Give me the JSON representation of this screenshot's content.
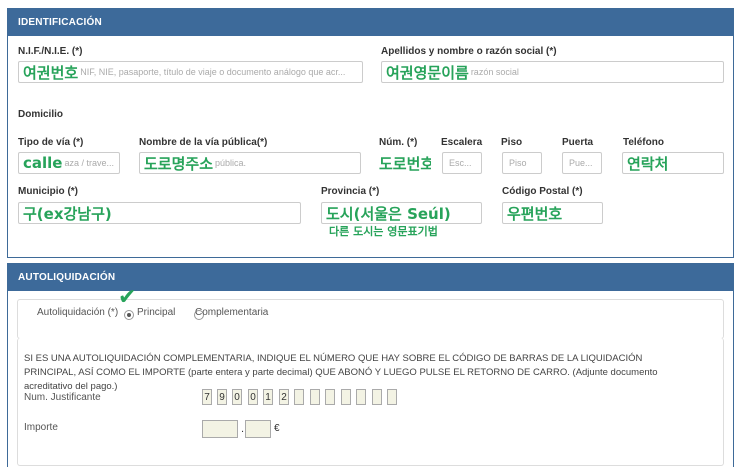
{
  "identificacion": {
    "header": "IDENTIFICACIÓN",
    "nif_label": "N.I.F./N.I.E. (*)",
    "nif_hand": "여권번호",
    "nif_placeholder": "NIF, NIE, pasaporte, título de viaje o documento análogo que acr...",
    "apellidos_label": "Apellidos y nombre o razón social (*)",
    "apellidos_hand": "여권영문이름",
    "apellidos_placeholder": "razón social",
    "domicilio_label": "Domicilio",
    "tipo_via_label": "Tipo de vía (*)",
    "tipo_via_hand": "calle",
    "tipo_via_placeholder": "aza / trave...",
    "nombre_via_label": "Nombre de la vía pública(*)",
    "nombre_via_hand": "도로명주소",
    "nombre_via_placeholder": "pública.",
    "num_label": "Núm. (*)",
    "num_hand": "도로번호",
    "escalera_label": "Escalera",
    "escalera_placeholder": "Esc...",
    "piso_label": "Piso",
    "piso_placeholder": "Piso",
    "puerta_label": "Puerta",
    "puerta_placeholder": "Pue...",
    "telefono_label": "Teléfono",
    "telefono_hand": "연락처",
    "municipio_label": "Municipio (*)",
    "municipio_hand": "구(ex강남구)",
    "provincia_label": "Provincia (*)",
    "provincia_hand": "도시(서울은 Seúl)",
    "provincia_note": "다른 도시는 영문표기법",
    "codigo_postal_label": "Código Postal (*)",
    "codigo_postal_hand": "우편번호"
  },
  "autoliquidacion": {
    "header": "AUTOLIQUIDACIÓN",
    "type_label": "Autoliquidación (*)",
    "option_principal": "Principal",
    "option_complementaria": "Complementaria",
    "selected": "Principal",
    "instructions": "SI ES UNA AUTOLIQUIDACIÓN COMPLEMENTARIA, INDIQUE EL NÚMERO QUE HAY SOBRE EL CÓDIGO DE BARRAS DE LA LIQUIDACIÓN PRINCIPAL, ASÍ COMO EL IMPORTE (parte entera y parte decimal) QUE ABONÓ Y LUEGO PULSE EL RETORNO DE CARRO. (Adjunte documento acreditativo del pago.)",
    "num_justificante_label": "Num. Justificante",
    "num_justificante_digits": [
      "7",
      "9",
      "0",
      "0",
      "1",
      "2",
      "",
      "",
      "",
      "",
      "",
      "",
      ""
    ],
    "importe_label": "Importe",
    "importe_separator": ".",
    "currency": "€"
  },
  "colors": {
    "header_bg": "#3d6a9a",
    "annotation": "#27a35a"
  }
}
